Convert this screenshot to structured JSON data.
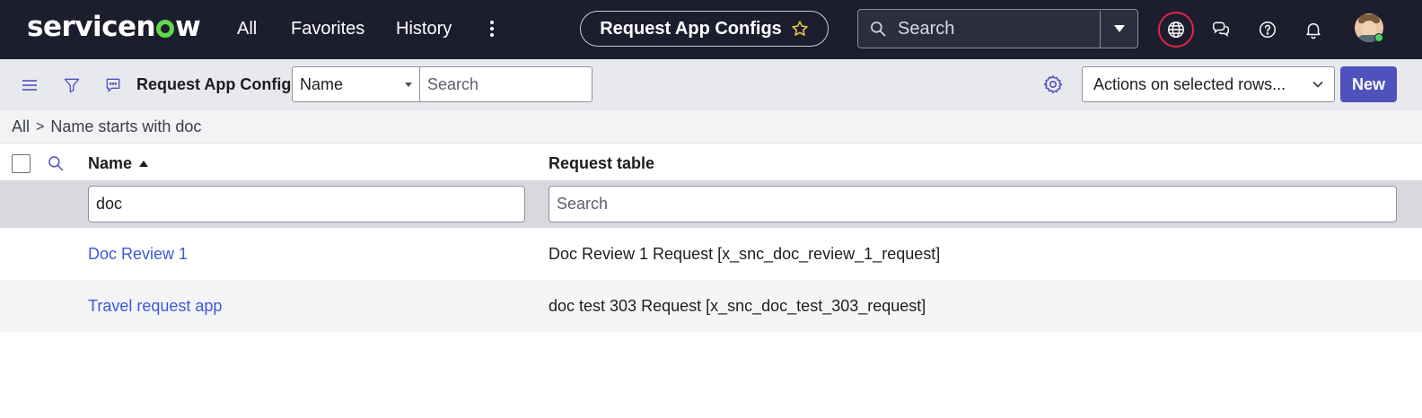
{
  "brand": {
    "logo_text_a": "servicen",
    "logo_text_b": "w"
  },
  "nav": {
    "all": "All",
    "favorites": "Favorites",
    "history": "History",
    "context_title": "Request App Configs",
    "search_text": "Search"
  },
  "icons": {
    "more": "more-vertical-icon",
    "star": "star-outline-icon",
    "search": "search-icon",
    "dropdown": "caret-down-icon",
    "globe": "globe-icon",
    "chat": "chat-icon",
    "help": "help-icon",
    "bell": "bell-icon",
    "menu": "hamburger-menu-icon",
    "filter": "filter-icon",
    "comment": "comment-icon",
    "gear": "gear-icon"
  },
  "listbar": {
    "title": "Request App Configs",
    "field_select": "Name",
    "search_placeholder": "Search",
    "actions_select": "Actions on selected rows...",
    "new_label": "New"
  },
  "breadcrumb": {
    "root": "All",
    "separator": ">",
    "condition": "Name starts with doc"
  },
  "table": {
    "columns": [
      "Name",
      "Request table"
    ],
    "filters": {
      "name_value": "doc",
      "request_table_placeholder": "Search"
    },
    "rows": [
      {
        "name": "Doc Review 1",
        "request_table": "Doc Review 1 Request [x_snc_doc_review_1_request]"
      },
      {
        "name": "Travel request app",
        "request_table": "doc test 303 Request [x_snc_doc_test_303_request]"
      }
    ]
  },
  "colors": {
    "topbar": "#1c1e2e",
    "accent": "#4f52bd",
    "link": "#3b59d9",
    "globe_ring": "#e2263f",
    "logo_o": "#62d84e"
  }
}
